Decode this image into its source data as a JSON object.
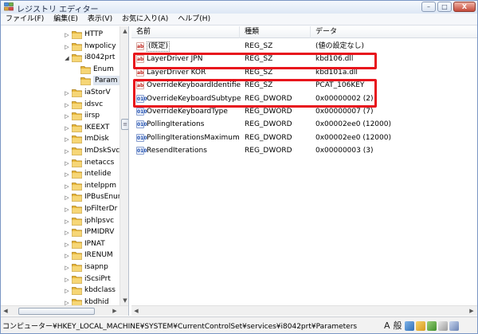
{
  "window": {
    "title": "レジストリ エディター",
    "controls": {
      "minimize": "–",
      "maximize": "□",
      "close": "X"
    }
  },
  "menu": [
    "ファイル(F)",
    "編集(E)",
    "表示(V)",
    "お気に入り(A)",
    "ヘルプ(H)"
  ],
  "tree": {
    "items": [
      {
        "label": "HTTP",
        "level": 0,
        "expander": "▷",
        "selected": false
      },
      {
        "label": "hwpolicy",
        "level": 0,
        "expander": "▷",
        "selected": false
      },
      {
        "label": "i8042prt",
        "level": 0,
        "expander": "◢",
        "selected": false
      },
      {
        "label": "Enum",
        "level": 1,
        "expander": "",
        "selected": false
      },
      {
        "label": "Param",
        "level": 1,
        "expander": "",
        "selected": true
      },
      {
        "label": "iaStorV",
        "level": 0,
        "expander": "▷",
        "selected": false
      },
      {
        "label": "idsvc",
        "level": 0,
        "expander": "▷",
        "selected": false
      },
      {
        "label": "iirsp",
        "level": 0,
        "expander": "▷",
        "selected": false
      },
      {
        "label": "IKEEXT",
        "level": 0,
        "expander": "▷",
        "selected": false
      },
      {
        "label": "ImDisk",
        "level": 0,
        "expander": "▷",
        "selected": false
      },
      {
        "label": "ImDskSvc",
        "level": 0,
        "expander": "▷",
        "selected": false
      },
      {
        "label": "inetaccs",
        "level": 0,
        "expander": "▷",
        "selected": false
      },
      {
        "label": "intelide",
        "level": 0,
        "expander": "▷",
        "selected": false
      },
      {
        "label": "intelppm",
        "level": 0,
        "expander": "▷",
        "selected": false
      },
      {
        "label": "IPBusEnur",
        "level": 0,
        "expander": "▷",
        "selected": false
      },
      {
        "label": "IpFilterDr",
        "level": 0,
        "expander": "▷",
        "selected": false
      },
      {
        "label": "iphlpsvc",
        "level": 0,
        "expander": "▷",
        "selected": false
      },
      {
        "label": "IPMIDRV",
        "level": 0,
        "expander": "▷",
        "selected": false
      },
      {
        "label": "IPNAT",
        "level": 0,
        "expander": "▷",
        "selected": false
      },
      {
        "label": "IRENUM",
        "level": 0,
        "expander": "▷",
        "selected": false
      },
      {
        "label": "isapnp",
        "level": 0,
        "expander": "▷",
        "selected": false
      },
      {
        "label": "iScsiPrt",
        "level": 0,
        "expander": "▷",
        "selected": false
      },
      {
        "label": "kbdclass",
        "level": 0,
        "expander": "▷",
        "selected": false
      },
      {
        "label": "kbdhid",
        "level": 0,
        "expander": "▷",
        "selected": false
      }
    ],
    "scroll_up": "▲",
    "scroll_down": "▼",
    "scroll_left": "◀",
    "scroll_right": "▶",
    "grip": "≡"
  },
  "list": {
    "columns": [
      "名前",
      "種類",
      "データ"
    ],
    "rows": [
      {
        "icon": "ab",
        "kind": "string-value-icon",
        "name": "(既定)",
        "type": "REG_SZ",
        "data": "(値の設定なし)",
        "is_default": true
      },
      {
        "icon": "ab",
        "kind": "string-value-icon",
        "name": "LayerDriver JPN",
        "type": "REG_SZ",
        "data": "kbd106.dll",
        "is_default": false
      },
      {
        "icon": "ab",
        "kind": "string-value-icon",
        "name": "LayerDriver KOR",
        "type": "REG_SZ",
        "data": "kbd101a.dll",
        "is_default": false
      },
      {
        "icon": "ab",
        "kind": "string-value-icon",
        "name": "OverrideKeyboardIdentifier",
        "type": "REG_SZ",
        "data": "PCAT_106KEY",
        "is_default": false
      },
      {
        "icon": "010",
        "kind": "dword-value-icon",
        "name": "OverrideKeyboardSubtype",
        "type": "REG_DWORD",
        "data": "0x00000002 (2)",
        "is_default": false
      },
      {
        "icon": "010",
        "kind": "dword-value-icon",
        "name": "OverrideKeyboardType",
        "type": "REG_DWORD",
        "data": "0x00000007 (7)",
        "is_default": false
      },
      {
        "icon": "010",
        "kind": "dword-value-icon",
        "name": "PollingIterations",
        "type": "REG_DWORD",
        "data": "0x00002ee0 (12000)",
        "is_default": false
      },
      {
        "icon": "010",
        "kind": "dword-value-icon",
        "name": "PollingIterationsMaximum",
        "type": "REG_DWORD",
        "data": "0x00002ee0 (12000)",
        "is_default": false
      },
      {
        "icon": "010",
        "kind": "dword-value-icon",
        "name": "ResendIterations",
        "type": "REG_DWORD",
        "data": "0x00000003 (3)",
        "is_default": false
      }
    ],
    "scroll_left": "◀",
    "scroll_right": "▶"
  },
  "status": {
    "path": "コンピューター¥HKEY_LOCAL_MACHINE¥SYSTEM¥CurrentControlSet¥services¥i8042prt¥Parameters",
    "ime_mode": "A",
    "ime_conversion": "般"
  },
  "colors": {
    "highlight": "#e8141c",
    "folder": "#e7b63a",
    "string_icon": "#c02018",
    "dword_icon": "#2050b0"
  }
}
